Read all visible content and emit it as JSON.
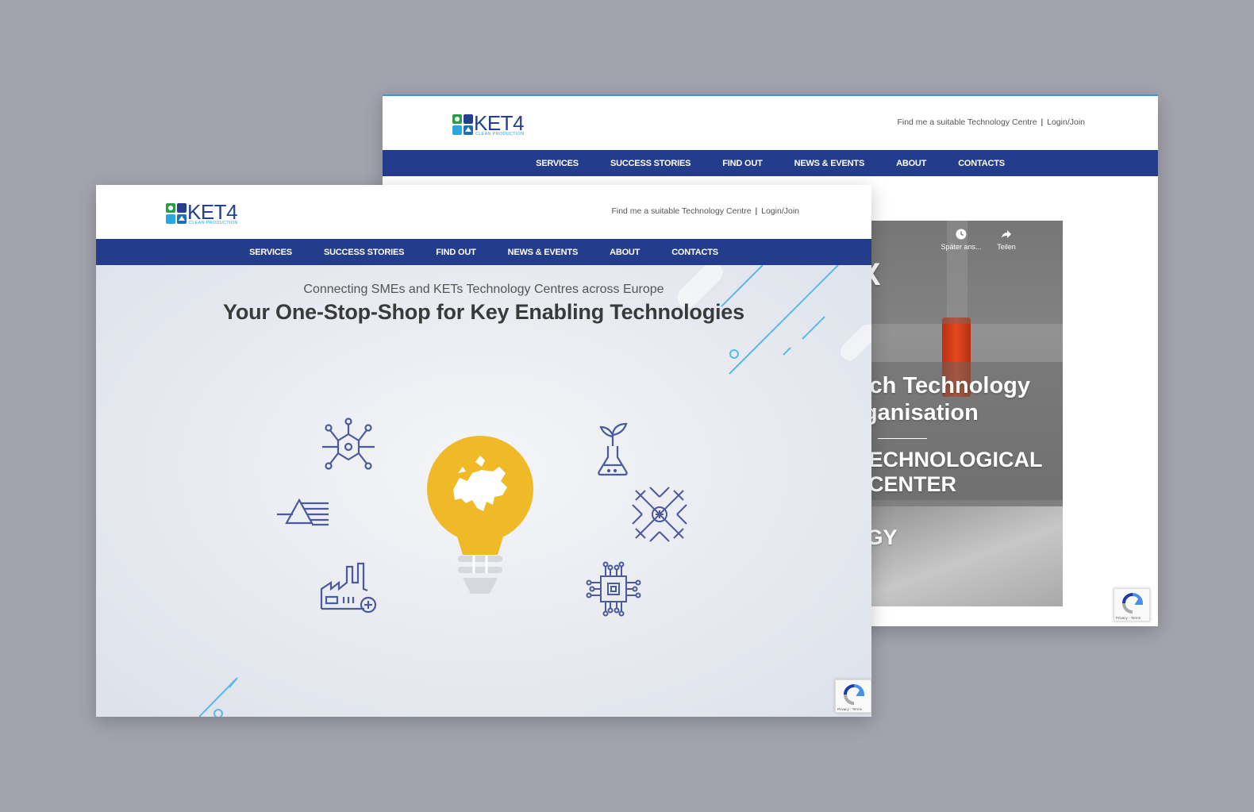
{
  "site": {
    "logo_text": "KET4",
    "logo_sub": "CLEAN PRODUCTION",
    "toplinks": {
      "find": "Find me a suitable Technology Centre",
      "separator": "|",
      "login": "Login/Join"
    },
    "nav": [
      "SERVICES",
      "SUCCESS STORIES",
      "FIND OUT",
      "NEWS & EVENTS",
      "ABOUT",
      "CONTACTS"
    ]
  },
  "hero": {
    "tagline": "Connecting SMEs and KETs Technology Centres across Europe",
    "headline": "Your One-Stop-Shop for Key Enabling Technologies",
    "icons": [
      "molecule-icon",
      "plant-flask-icon",
      "prism-icon",
      "nanomaterial-icon",
      "factory-icon",
      "microchip-icon",
      "europe-lightbulb-icon"
    ]
  },
  "video": {
    "watch_later": "Später ans...",
    "share": "Teilen",
    "overlay_lines": [
      "AX",
      "earch Technology",
      "Organisation",
      "T TECHNOLOGICAL",
      "CENTER",
      "LOGY"
    ]
  },
  "recaptcha": {
    "text": "Privacy - Terms"
  },
  "colors": {
    "nav": "#243c8c",
    "accent_blue": "#2aa7de",
    "bulb_yellow": "#f0b928",
    "icon_stroke": "#4b5a9e",
    "background": "#a3a3ad"
  }
}
